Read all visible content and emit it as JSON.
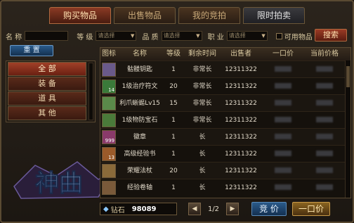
{
  "tabs": [
    "购买物品",
    "出售物品",
    "我的竞拍",
    "限时拍卖"
  ],
  "filters": {
    "name_label": "名 称",
    "level_label": "等 级",
    "quality_label": "品 质",
    "job_label": "职 业",
    "placeholder": "请选择",
    "usable_label": "可用物品",
    "search_label": "搜索"
  },
  "reset_label": "重 置",
  "categories": [
    "全 部",
    "装 备",
    "道 具",
    "其 他"
  ],
  "columns": [
    "图标",
    "名称",
    "等级",
    "剩余时间",
    "出售者",
    "一口价",
    "当前价格"
  ],
  "rows": [
    {
      "icon_color": "#6a5a8a",
      "badge": "",
      "name": "骷髅钥匙",
      "level": "1",
      "time": "非常长",
      "seller": "12311322"
    },
    {
      "icon_color": "#3a7a3a",
      "badge": "14",
      "name": "1级治疗符文",
      "level": "20",
      "time": "非常长",
      "seller": "12311322"
    },
    {
      "icon_color": "#5a8a4a",
      "badge": "",
      "name": "利爪蜥蜴Lv15",
      "level": "15",
      "time": "非常长",
      "seller": "12311322"
    },
    {
      "icon_color": "#4a7a3a",
      "badge": "",
      "name": "1级物防宝石",
      "level": "1",
      "time": "非常长",
      "seller": "12311322"
    },
    {
      "icon_color": "#8a3a6a",
      "badge": "999",
      "name": "徽章",
      "level": "1",
      "time": "长",
      "seller": "12311322"
    },
    {
      "icon_color": "#9a5a2a",
      "badge": "13",
      "name": "高级经验书",
      "level": "1",
      "time": "长",
      "seller": "12311322"
    },
    {
      "icon_color": "#8a6a3a",
      "badge": "",
      "name": "荣耀法杖",
      "level": "20",
      "time": "长",
      "seller": "12311322"
    },
    {
      "icon_color": "#7a5a3a",
      "badge": "",
      "name": "经验卷轴",
      "level": "1",
      "time": "长",
      "seller": "12311322"
    }
  ],
  "bottom": {
    "currency_label": "钻石",
    "currency_value": "98089",
    "page": "1/2",
    "bid_label": "竞 价",
    "buyout_label": "一口价"
  },
  "logo_text": "神曲"
}
